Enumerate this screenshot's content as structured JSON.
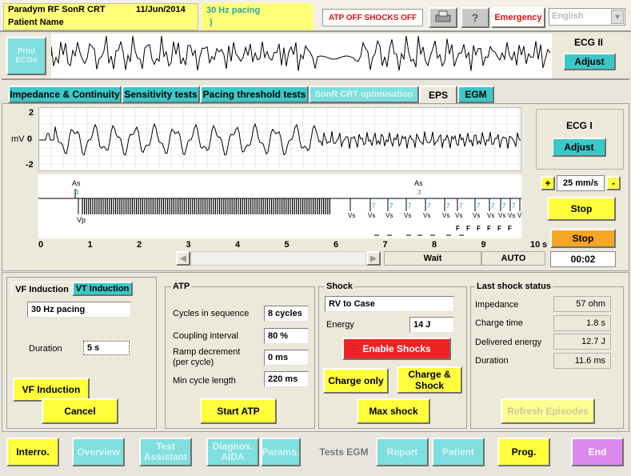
{
  "header": {
    "device": "Paradym RF SonR CRT",
    "date": "11/Jun/2014",
    "patient_label": "Patient Name",
    "mode": "30 Hz pacing",
    "mode_sub": ")",
    "atp_status": "ATP OFF SHOCKS OFF",
    "emergency": "Emergency",
    "language": "English",
    "print_icon": "printer-icon",
    "help_icon": "help-icon"
  },
  "ecg_strip": {
    "print_label": "Print ECGs",
    "title": "ECG II",
    "adjust": "Adjust"
  },
  "tabs": [
    {
      "label": "Impedance & Continuity"
    },
    {
      "label": "Sensitivity tests"
    },
    {
      "label": "Pacing threshold tests"
    },
    {
      "label": "SonR CRT optimisation"
    },
    {
      "label": "EPS"
    },
    {
      "label": "EGM"
    }
  ],
  "ecg_main": {
    "y_top": "2",
    "y_mid": "0",
    "y_bot": "-2",
    "unit": "mV",
    "title": "ECG I",
    "adjust": "Adjust",
    "plus": "+",
    "minus": "-",
    "speed": "25 mm/s",
    "stop1": "Stop",
    "stop2": "Stop",
    "ticks": [
      "0",
      "1",
      "2",
      "3",
      "4",
      "5",
      "6",
      "7",
      "8",
      "9",
      "10"
    ],
    "unit_s": "s",
    "wait": "Wait",
    "auto": "AUTO",
    "timer": "00:02",
    "marker_as": "As",
    "marker_3": "3",
    "marker_vp": "Vp",
    "marker_vs": "Vs",
    "marker_7": "7",
    "marker_f": "F"
  },
  "induction": {
    "tab_vf": "VF Induction",
    "tab_vt": "VT Induction",
    "mode_value": "30 Hz pacing",
    "duration_label": "Duration",
    "duration_value": "5 s",
    "vf_button": "VF Induction",
    "cancel": "Cancel"
  },
  "atp": {
    "legend": "ATP",
    "rows": [
      {
        "label": "Cycles in sequence",
        "value": "8 cycles"
      },
      {
        "label": "Coupling interval",
        "value": "80 %"
      },
      {
        "label": "Ramp decrement (per cycle)",
        "value": "0 ms"
      },
      {
        "label": "Min cycle length",
        "value": "220 ms"
      }
    ],
    "start": "Start ATP"
  },
  "shock": {
    "legend": "Shock",
    "vector": "RV to Case",
    "energy_label": "Energy",
    "energy_value": "14 J",
    "enable": "Enable Shocks",
    "charge_only": "Charge only",
    "charge_shock": "Charge & Shock",
    "max": "Max shock"
  },
  "last_shock": {
    "legend": "Last shock status",
    "rows": [
      {
        "label": "Impedance",
        "value": "57 ohm"
      },
      {
        "label": "Charge time",
        "value": "1.8 s"
      },
      {
        "label": "Delivered energy",
        "value": "12.7 J"
      },
      {
        "label": "Duration",
        "value": "11.6 ms"
      }
    ],
    "refresh": "Refresh Episodes"
  },
  "nav": [
    {
      "label": "Interro."
    },
    {
      "label": "Overview"
    },
    {
      "label": "Test Assistant"
    },
    {
      "label": "Diagnos. AIDA"
    },
    {
      "label": "Params."
    },
    {
      "label": "Tests EGM"
    },
    {
      "label": "Report"
    },
    {
      "label": "Patient"
    },
    {
      "label": "Prog."
    },
    {
      "label": "End"
    }
  ]
}
